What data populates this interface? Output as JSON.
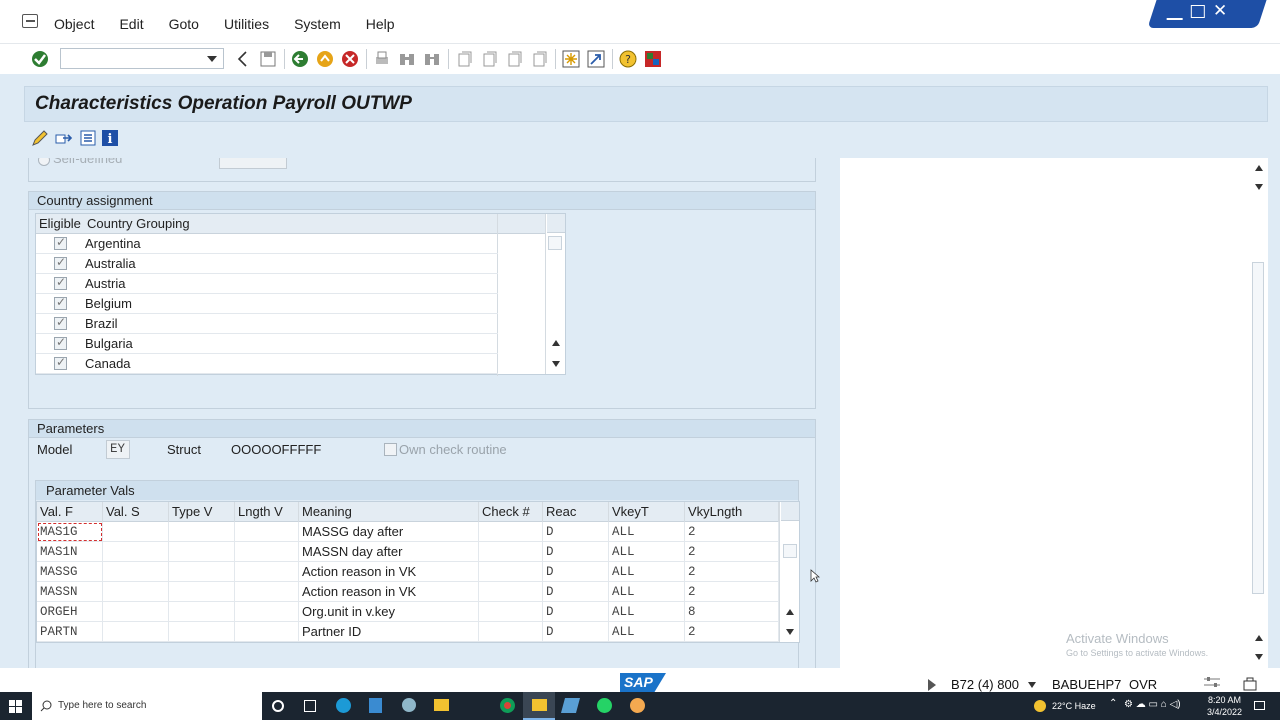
{
  "menubar": {
    "items": [
      "Object",
      "Edit",
      "Goto",
      "Utilities",
      "System",
      "Help"
    ]
  },
  "window": {
    "title": "Characteristics Operation Payroll OUTWP"
  },
  "toolbar": {
    "command_field_value": "",
    "icons": [
      "enter-icon",
      "back-icon",
      "save-icon",
      "green-back-icon",
      "exit-icon",
      "cancel-icon",
      "print-icon",
      "find-icon",
      "find-next-icon",
      "first-page-icon",
      "prev-page-icon",
      "next-page-icon",
      "last-page-icon",
      "create-session-icon",
      "shortcut-icon",
      "help-icon",
      "layout-icon"
    ]
  },
  "app_toolbar": {
    "icons": [
      "edit-icon",
      "transport-icon",
      "list-icon",
      "info-icon"
    ]
  },
  "partial_top": {
    "radio_label": "Self-defined"
  },
  "country_assignment": {
    "title": "Country assignment",
    "col_eligible": "Eligible",
    "col_grouping": "Country Grouping",
    "rows": [
      {
        "eligible": true,
        "country": "Argentina"
      },
      {
        "eligible": true,
        "country": "Australia"
      },
      {
        "eligible": true,
        "country": "Austria"
      },
      {
        "eligible": true,
        "country": "Belgium"
      },
      {
        "eligible": true,
        "country": "Brazil"
      },
      {
        "eligible": true,
        "country": "Bulgaria"
      },
      {
        "eligible": true,
        "country": "Canada"
      }
    ]
  },
  "parameters": {
    "title": "Parameters",
    "model_label": "Model",
    "model_value": "EY",
    "struct_label": "Struct",
    "struct_value": "OOOOOFFFFF",
    "own_check_label": "Own check routine"
  },
  "param_vals": {
    "title": "Parameter Vals",
    "columns": [
      "Val. F",
      "Val. S",
      "Type V",
      "Lngth V",
      "Meaning",
      "Check #",
      "Reac",
      "VkeyT",
      "VkyLngth"
    ],
    "rows": [
      [
        "MAS1G",
        "",
        "",
        "",
        "MASSG day after",
        "",
        "D",
        "ALL",
        "2"
      ],
      [
        "MAS1N",
        "",
        "",
        "",
        "MASSN day after",
        "",
        "D",
        "ALL",
        "2"
      ],
      [
        "MASSG",
        "",
        "",
        "",
        "Action reason in VK",
        "",
        "D",
        "ALL",
        "2"
      ],
      [
        "MASSN",
        "",
        "",
        "",
        "Action reason in VK",
        "",
        "D",
        "ALL",
        "2"
      ],
      [
        "ORGEH",
        "",
        "",
        "",
        "Org.unit in v.key",
        "",
        "D",
        "ALL",
        "8"
      ],
      [
        "PARTN",
        "",
        "",
        "",
        "Partner ID",
        "",
        "D",
        "ALL",
        "2"
      ]
    ]
  },
  "statusbar": {
    "logo": "SAP",
    "system": "B72 (4) 800",
    "server": "BABUEHP7",
    "mode": "OVR"
  },
  "watermark": {
    "line1": "Activate Windows",
    "line2": "Go to Settings to activate Windows."
  },
  "taskbar": {
    "search_placeholder": "Type here to search",
    "weather": "22°C  Haze",
    "time": "8:20 AM",
    "date": "3/4/2022"
  }
}
